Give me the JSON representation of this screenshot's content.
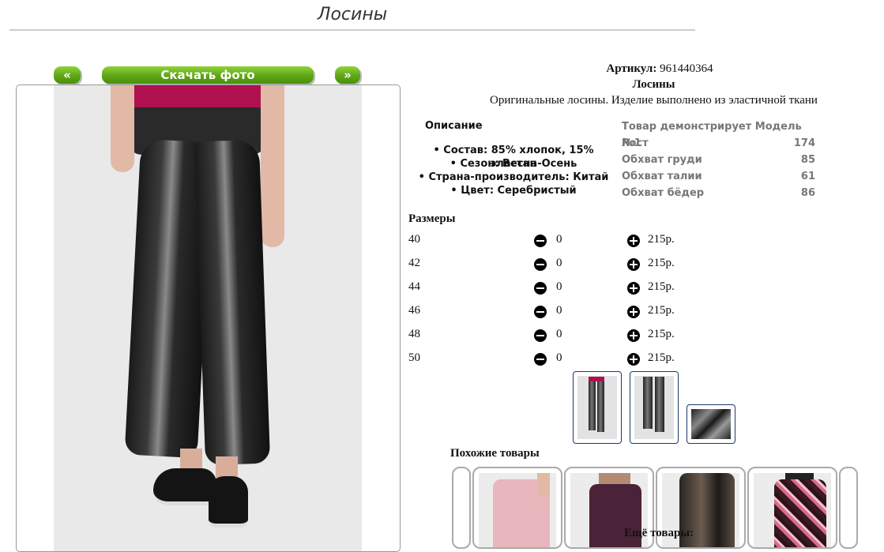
{
  "page": {
    "title": "Лосины"
  },
  "gallery": {
    "prev_label": "«",
    "download_label": "Скачать фото",
    "next_label": "»"
  },
  "product": {
    "article_label": "Артикул:",
    "article_value": "961440364",
    "name": "Лосины",
    "description": "Оригинальные лосины. Изделие выполнено из эластичной ткани"
  },
  "details": {
    "heading": "Описание",
    "items": [
      "Состав: 85% хлопок, 15% эластан",
      "Сезон: Весна-Осень",
      "Страна-производитель: Китай",
      "Цвет: Серебристый"
    ]
  },
  "model": {
    "heading": "Товар демонстрирует Модель №1",
    "rows": [
      {
        "label": "Рост",
        "value": "174"
      },
      {
        "label": "Обхват груди",
        "value": "85"
      },
      {
        "label": "Обхват талии",
        "value": "61"
      },
      {
        "label": "Обхват бёдер",
        "value": "86"
      }
    ]
  },
  "sizes": {
    "heading": "Размеры",
    "rows": [
      {
        "size": "40",
        "qty": "0",
        "price": "215р."
      },
      {
        "size": "42",
        "qty": "0",
        "price": "215р."
      },
      {
        "size": "44",
        "qty": "0",
        "price": "215р."
      },
      {
        "size": "46",
        "qty": "0",
        "price": "215р."
      },
      {
        "size": "48",
        "qty": "0",
        "price": "215р."
      },
      {
        "size": "50",
        "qty": "0",
        "price": "215р."
      }
    ]
  },
  "similar": {
    "heading": "Похожие товары"
  },
  "more": {
    "heading": "Ещё товары:"
  },
  "colors": {
    "accent_green": "#5ea516",
    "thumb_border": "#1e3a6b",
    "top_magenta": "#b0104f"
  }
}
